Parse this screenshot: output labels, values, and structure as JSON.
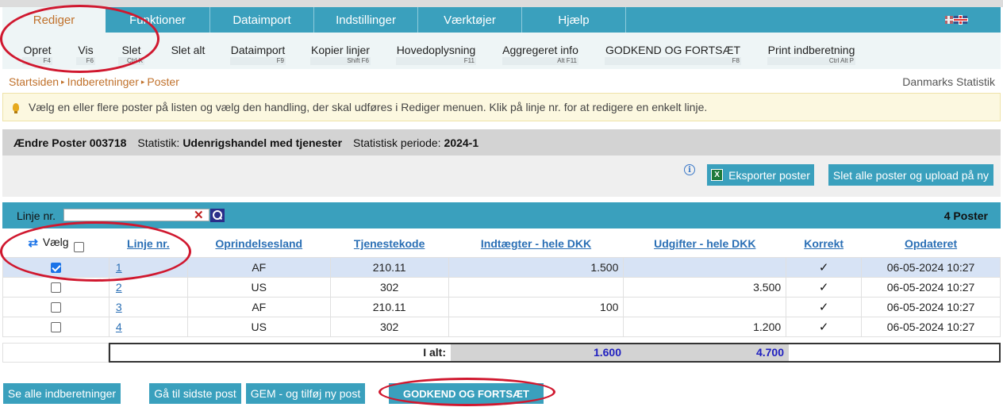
{
  "menu": {
    "tabs": [
      {
        "label": "Rediger"
      },
      {
        "label": "Funktioner"
      },
      {
        "label": "Dataimport"
      },
      {
        "label": "Indstillinger"
      },
      {
        "label": "Værktøjer"
      },
      {
        "label": "Hjælp"
      }
    ],
    "active_index": 0
  },
  "submenu": {
    "items": [
      {
        "label": "Opret",
        "key": "F4"
      },
      {
        "label": "Vis",
        "key": "F6"
      },
      {
        "label": "Slet",
        "key": "Ctrl X"
      },
      {
        "label": "Slet alt",
        "key": ""
      },
      {
        "label": "Dataimport",
        "key": "F9"
      },
      {
        "label": "Kopier linjer",
        "key": "Shift F6"
      },
      {
        "label": "Hovedoplysning",
        "key": "F11"
      },
      {
        "label": "Aggregeret info",
        "key": "Alt F11"
      },
      {
        "label": "GODKEND OG FORTSÆT",
        "key": "F8"
      },
      {
        "label": "Print indberetning",
        "key": "Ctrl Alt P"
      }
    ]
  },
  "breadcrumb": {
    "items": [
      "Startsiden",
      "Indberetninger",
      "Poster"
    ]
  },
  "organization": "Danmarks Statistik",
  "info_message": "Vælg en eller flere poster på listen og vælg den handling, der skal udføres i Rediger menuen. Klik på linje nr. for at redigere en enkelt linje.",
  "record": {
    "title": "Ændre Poster 003718",
    "statistic_label": "Statistik:",
    "statistic_value": "Udenrigshandel med tjenester",
    "period_label": "Statistisk periode:",
    "period_value": "2024-1"
  },
  "actions": {
    "export_label": "Eksporter poster",
    "delete_all_label": "Slet alle poster og upload på ny"
  },
  "filter": {
    "label": "Linje nr.",
    "value": "",
    "count_label": "4 Poster"
  },
  "table": {
    "select_label": "Vælg",
    "columns": [
      "Linje nr.",
      "Oprindelsesland",
      "Tjenestekode",
      "Indtægter - hele DKK",
      "Udgifter - hele DKK",
      "Korrekt",
      "Opdateret"
    ],
    "rows": [
      {
        "checked": true,
        "line": "1",
        "country": "AF",
        "code": "210.11",
        "income": "1.500",
        "expense": "",
        "correct": "✓",
        "updated": "06-05-2024 10:27"
      },
      {
        "checked": false,
        "line": "2",
        "country": "US",
        "code": "302",
        "income": "",
        "expense": "3.500",
        "correct": "✓",
        "updated": "06-05-2024 10:27"
      },
      {
        "checked": false,
        "line": "3",
        "country": "AF",
        "code": "210.11",
        "income": "100",
        "expense": "",
        "correct": "✓",
        "updated": "06-05-2024 10:27"
      },
      {
        "checked": false,
        "line": "4",
        "country": "US",
        "code": "302",
        "income": "",
        "expense": "1.200",
        "correct": "✓",
        "updated": "06-05-2024 10:27"
      }
    ],
    "totals": {
      "label": "I alt:",
      "income": "1.600",
      "expense": "4.700"
    }
  },
  "bottom_buttons": {
    "see_all": "Se alle indberetninger",
    "goto_last": "Gå til sidste post",
    "save_add": "GEM - og tilføj ny post",
    "approve": "GODKEND OG FORTSÆT"
  },
  "colors": {
    "accent": "#3aa0bd",
    "link": "#2a6fb5",
    "breadcrumb": "#c0712b",
    "annotation": "#d0182f"
  }
}
